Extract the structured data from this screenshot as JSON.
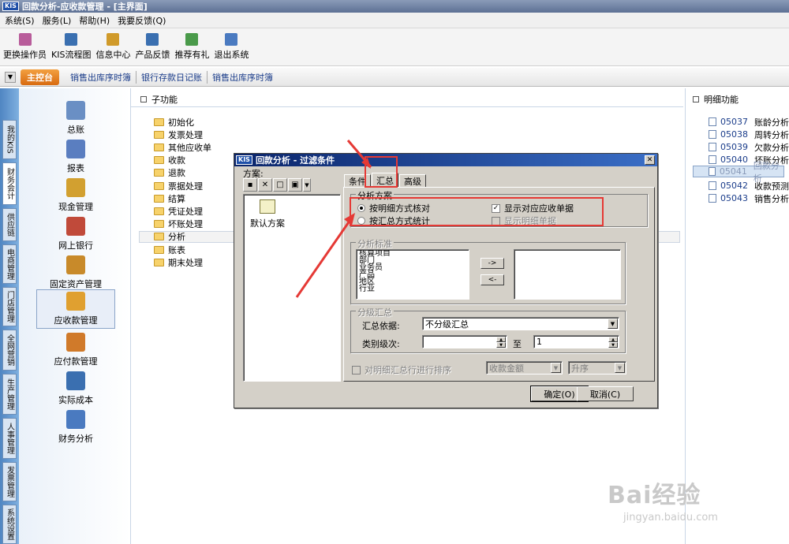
{
  "window": {
    "logo": "KIS",
    "title": "回款分析-应收款管理 - [主界面]"
  },
  "menu": [
    "系统(S)",
    "服务(L)",
    "帮助(H)",
    "我要反馈(Q)"
  ],
  "toolbar": [
    {
      "label": "更换操作员",
      "icon": "user-switch-icon",
      "color": "#b85c9a"
    },
    {
      "label": "KIS流程图",
      "icon": "flowchart-icon",
      "color": "#3a6fb0"
    },
    {
      "label": "信息中心",
      "icon": "message-icon",
      "color": "#d09a2a"
    },
    {
      "label": "产品反馈",
      "icon": "feedback-icon",
      "color": "#3a6fb0"
    },
    {
      "label": "推荐有礼",
      "icon": "gift-icon",
      "color": "#4a9a4a"
    },
    {
      "label": "退出系统",
      "icon": "exit-icon",
      "color": "#4a7ac0"
    }
  ],
  "tabs": {
    "main": "主控台",
    "items": [
      "销售出库序时簿",
      "银行存款日记账",
      "销售出库序时簿"
    ]
  },
  "vtabs": [
    "我的KIS",
    "财务会计",
    "供应链",
    "电商管理",
    "门店管理",
    "全网营销",
    "生产管理",
    "人事管理",
    "发票管理",
    "系统设置"
  ],
  "modules": [
    {
      "label": "总账",
      "icon": "ledger-icon",
      "color": "#6a8fc4"
    },
    {
      "label": "报表",
      "icon": "report-icon",
      "color": "#5a7ec0"
    },
    {
      "label": "现金管理",
      "icon": "cash-icon",
      "color": "#d2a030"
    },
    {
      "label": "网上银行",
      "icon": "bank-icon",
      "color": "#c04a3a"
    },
    {
      "label": "固定资产管理",
      "icon": "asset-icon",
      "color": "#c88a2a"
    },
    {
      "label": "应收款管理",
      "icon": "receivable-icon",
      "color": "#e0a030"
    },
    {
      "label": "应付款管理",
      "icon": "payable-icon",
      "color": "#d07a2a"
    },
    {
      "label": "实际成本",
      "icon": "cost-icon",
      "color": "#3a6fb0"
    },
    {
      "label": "财务分析",
      "icon": "analysis-icon",
      "color": "#4a7ac0"
    }
  ],
  "sub": {
    "header": "子功能",
    "folders": [
      "初始化",
      "发票处理",
      "其他应收单",
      "收款",
      "退款",
      "票据处理",
      "结算",
      "凭证处理",
      "坏账处理",
      "分析",
      "账表",
      "期末处理"
    ],
    "selected_index": 9
  },
  "detail": {
    "header": "明细功能",
    "items": [
      {
        "code": "05037",
        "name": "账龄分析"
      },
      {
        "code": "05038",
        "name": "周转分析"
      },
      {
        "code": "05039",
        "name": "欠款分析"
      },
      {
        "code": "05040",
        "name": "坏账分析"
      },
      {
        "code": "05041",
        "name": "回款分析"
      },
      {
        "code": "05042",
        "name": "收款预测"
      },
      {
        "code": "05043",
        "name": "销售分析"
      }
    ],
    "selected_index": 4
  },
  "dialog": {
    "logo": "KIS",
    "title": "回款分析 - 过滤条件",
    "plan_label": "方案:",
    "plan_item": "默认方案",
    "tabs": [
      "条件",
      "汇总",
      "高级"
    ],
    "active_tab": 1,
    "scheme_group": "分析方案",
    "opt_detail": "按明细方式核对",
    "opt_summary": "按汇总方式统计",
    "chk_show": "显示对应应收单据",
    "chk_detail": "显示明细单据",
    "std_group": "分析标准",
    "std_items": [
      "核算项目",
      "部门",
      "业务员",
      "产品",
      "地区",
      "行业"
    ],
    "btn_right": "->",
    "btn_left": "<-",
    "level_group": "分级汇总",
    "basis_label": "汇总依据:",
    "basis_value": "不分级汇总",
    "level_label": "类别级次:",
    "level_to": "至",
    "level_from_value": "",
    "level_to_value": "1",
    "sort_label": "对明细汇总行进行排序",
    "sort_field": "收款金额",
    "sort_order": "升序",
    "ok": "确定(O)",
    "cancel": "取消(C)"
  },
  "watermark": {
    "brand": "Bai经验",
    "url": "jingyan.baidu.com"
  }
}
